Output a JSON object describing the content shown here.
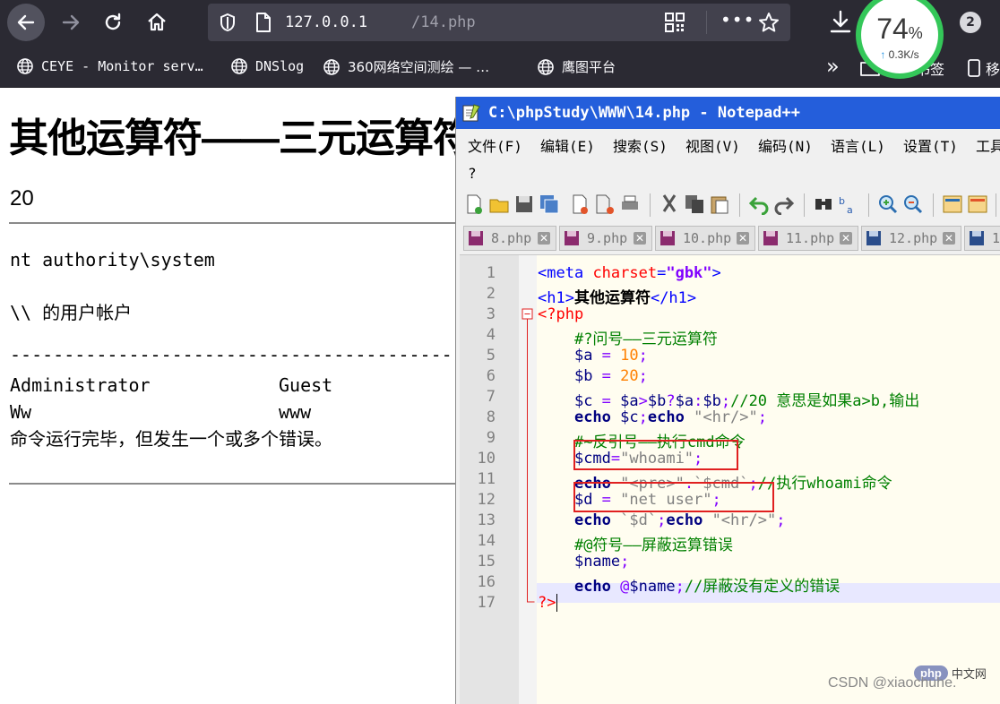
{
  "browser": {
    "url_host": "127.0.0.1",
    "url_path": "/14.php",
    "badge_count": "2",
    "speed": {
      "percent": "74",
      "percent_unit": "%",
      "rate": "0.3K/s"
    },
    "bookmarks": [
      {
        "label": "CEYE - Monitor serv…"
      },
      {
        "label": "DNSlog"
      },
      {
        "label": "360网络空间测绘 — …"
      },
      {
        "label": "鹰图平台"
      }
    ],
    "bookmark_folder": "移动书签",
    "bookmark_last": "移"
  },
  "page": {
    "title": "其他运算符——三元运算符",
    "result_ternary": "20",
    "whoami_output": "nt authority\\system",
    "account_header": "\\\\ 的用户帐户",
    "separator": "-------------------------------------------------------------------------------",
    "users_row1_col1": "Administrator",
    "users_row1_col2": "Guest",
    "users_row2_col1": "Ww",
    "users_row2_col2": "www",
    "done_message": "命令运行完毕，但发生一个或多个错误。"
  },
  "notepad": {
    "title": "C:\\phpStudy\\WWW\\14.php - Notepad++",
    "menu": [
      "文件(F)",
      "编辑(E)",
      "搜索(S)",
      "视图(V)",
      "编码(N)",
      "语言(L)",
      "设置(T)",
      "工具"
    ],
    "help": "?",
    "tabs": [
      "8.php",
      "9.php",
      "10.php",
      "11.php",
      "12.php",
      "1"
    ],
    "line_numbers": [
      "1",
      "2",
      "3",
      "4",
      "5",
      "6",
      "7",
      "8",
      "9",
      "10",
      "11",
      "12",
      "13",
      "14",
      "15",
      "16",
      "17"
    ],
    "code": {
      "l1_a": "<meta",
      "l1_b": "charset",
      "l1_c": "=",
      "l1_d": "\"gbk\"",
      "l1_e": ">",
      "l2_a": "<h1>",
      "l2_b": "其他运算符",
      "l2_c": "</h1>",
      "l3": "<?php",
      "l4": "#?问号——三元运算符",
      "l5_a": "$a",
      "l5_b": " = ",
      "l5_c": "10",
      "l5_d": ";",
      "l6_a": "$b",
      "l6_b": " = ",
      "l6_c": "20",
      "l6_d": ";",
      "l7_a": "$c",
      "l7_b": " = ",
      "l7_c": "$a",
      "l7_d": ">",
      "l7_e": "$b",
      "l7_f": "?",
      "l7_g": "$a",
      "l7_h": ":",
      "l7_i": "$b",
      "l7_j": ";",
      "l7_k": "//20 意思是如果a>b,输出",
      "l8_a": "echo",
      "l8_b": " ",
      "l8_c": "$c",
      "l8_d": ";",
      "l8_e": "echo",
      "l8_f": " ",
      "l8_g": "\"<hr/>\"",
      "l8_h": ";",
      "l9": "#~反引号——执行cmd命令",
      "l10_a": "$cmd",
      "l10_b": "=",
      "l10_c": "\"whoami\"",
      "l10_d": ";",
      "l11_a": "echo",
      "l11_b": " ",
      "l11_c": "\"<pre>\"",
      "l11_d": ".",
      "l11_e": "`$cmd`",
      "l11_f": ";",
      "l11_g": "//执行whoami命令",
      "l12_a": "$d",
      "l12_b": " = ",
      "l12_c": "\"net user\"",
      "l12_d": ";",
      "l13_a": "echo",
      "l13_b": " ",
      "l13_c": "`$d`",
      "l13_d": ";",
      "l13_e": "echo",
      "l13_f": " ",
      "l13_g": "\"<hr/>\"",
      "l13_h": ";",
      "l14": "#@符号——屏蔽运算错误",
      "l15_a": "$name",
      "l15_b": ";",
      "l16_a": "echo",
      "l16_b": " @",
      "l16_c": "$name",
      "l16_d": ";",
      "l16_e": "//屏蔽没有定义的错误",
      "l17": "?>"
    }
  },
  "watermark": "CSDN @xiaochuhe.",
  "php_logo": {
    "text": "php",
    "cn": "中文网"
  },
  "colors": {
    "browser_bg": "#2b2a33",
    "urlbar_bg": "#42414d",
    "npp_title": "#245edb",
    "highlight_box": "#e02020",
    "speed_ring": "#34c759"
  }
}
